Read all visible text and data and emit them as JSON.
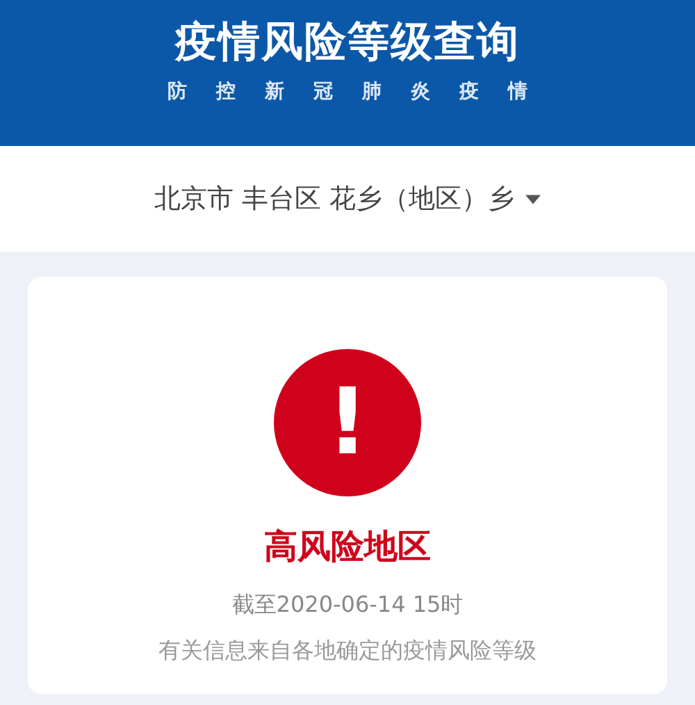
{
  "header": {
    "title": "疫情风险等级查询",
    "subtitle": [
      "防",
      "控",
      "新",
      "冠",
      "肺",
      "炎",
      "疫",
      "情"
    ]
  },
  "location": {
    "value": "北京市 丰台区 花乡（地区）乡"
  },
  "result": {
    "kind": "high",
    "mark": "!",
    "level_text": "高风险地区",
    "time": "截至2020-06-14 15时",
    "note": "有关信息来自各地确定的疫情风险等级"
  }
}
